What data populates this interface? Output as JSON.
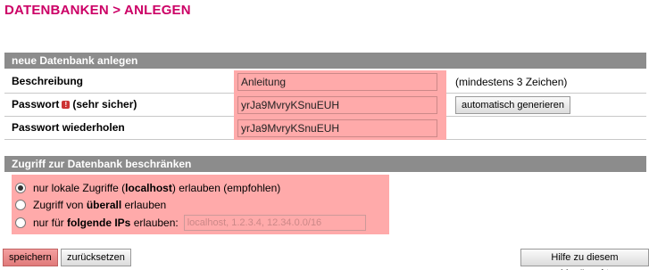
{
  "page": {
    "title": "DATENBANKEN > ANLEGEN"
  },
  "new_db": {
    "header": "neue Datenbank anlegen",
    "description": {
      "label": "Beschreibung",
      "value": "Anleitung",
      "hint": "(mindestens 3 Zeichen)"
    },
    "password": {
      "label": "Passwort",
      "strength": "(sehr sicher)",
      "warn_icon": "!",
      "value": "yrJa9MvryKSnuEUH",
      "generate_label": "automatisch generieren"
    },
    "password_repeat": {
      "label": "Passwort wiederholen",
      "value": "yrJa9MvryKSnuEUH"
    }
  },
  "access": {
    "header": "Zugriff zur Datenbank beschränken",
    "options": [
      {
        "pre": "nur lokale Zugriffe (",
        "bold": "localhost",
        "post": ") erlauben (empfohlen)",
        "checked": true
      },
      {
        "pre": "Zugriff von ",
        "bold": "überall",
        "post": " erlauben",
        "checked": false
      },
      {
        "pre": "nur für ",
        "bold": "folgende IPs",
        "post": " erlauben:",
        "checked": false
      }
    ],
    "ip_placeholder": "localhost, 1.2.3.4, 12.34.0.0/16"
  },
  "actions": {
    "save": "speichern",
    "reset": "zurücksetzen",
    "help": "Hilfe zu diesem Menüpunkt"
  },
  "colors": {
    "title": "#cc0066",
    "section_header": "#8c8c8c",
    "highlight": "#ffaaaa"
  }
}
